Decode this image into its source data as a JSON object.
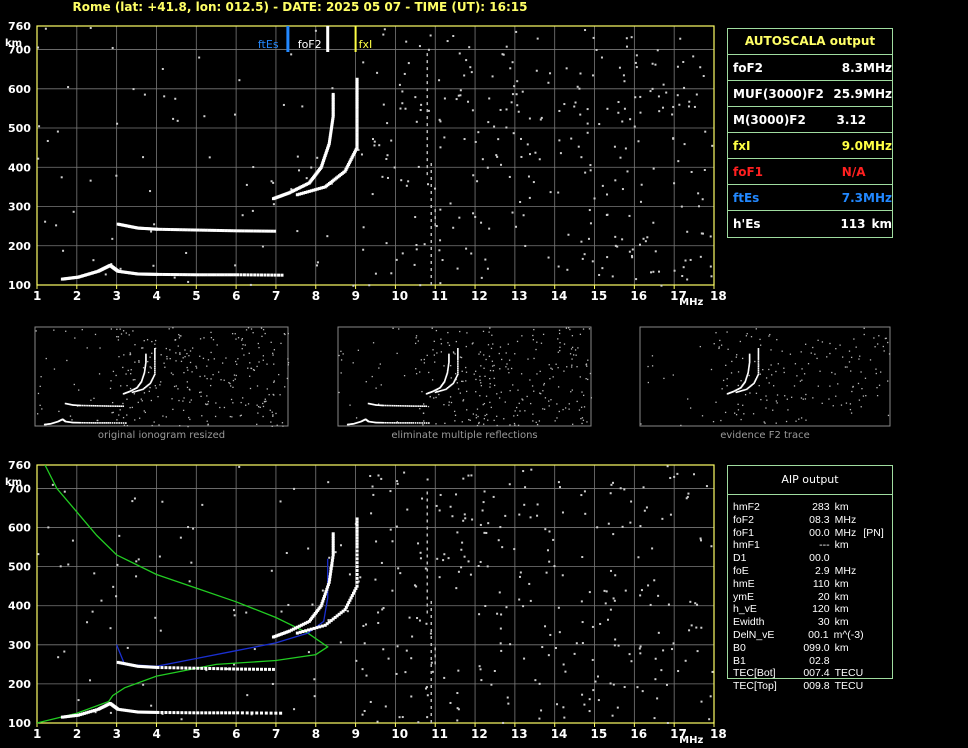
{
  "header": "Rome (lat: +41.8, lon: 012.5) - DATE: 2025 05 07 - TIME (UT): 16:15",
  "colors": {
    "grid": "#7a7a7a",
    "axis": "#ffff66",
    "es": "#2288ff",
    "f1": "#ff2020",
    "fxi": "#ffff44",
    "profile_green": "#22cc22",
    "profile_blue": "#1a2fd0",
    "trace": "#ffffff"
  },
  "axes": {
    "y_unit": "km",
    "x_unit": "MHz",
    "y_ticks": [
      760,
      700,
      600,
      500,
      400,
      300,
      200,
      100
    ],
    "x_ticks": [
      1,
      2,
      3,
      4,
      5,
      6,
      7,
      8,
      9,
      10,
      11,
      12,
      13,
      14,
      15,
      16,
      17,
      18
    ]
  },
  "markers": {
    "ftEs": "ftEs",
    "foF2": "foF2",
    "fxI": "fxI"
  },
  "autoscala": {
    "title": "AUTOSCALA output",
    "rows": [
      {
        "label": "foF2",
        "value": "8.3",
        "unit": "MHz",
        "color": "#ffffff"
      },
      {
        "label": "MUF(3000)F2",
        "value": "25.9",
        "unit": "MHz",
        "color": "#ffffff"
      },
      {
        "label": "M(3000)F2",
        "value": "3.12",
        "unit": "",
        "color": "#ffffff"
      },
      {
        "label": "fxI",
        "value": "9.0",
        "unit": "MHz",
        "color": "#ffff44"
      },
      {
        "label": "foF1",
        "value": "N/A",
        "unit": "",
        "color": "#ff2020"
      },
      {
        "label": "ftEs",
        "value": "7.3",
        "unit": "MHz",
        "color": "#2288ff"
      },
      {
        "label": "h'Es",
        "value": "113",
        "unit": "km",
        "color": "#ffffff"
      }
    ]
  },
  "thumbnails": [
    "original ionogram resized",
    "eliminate multiple reflections",
    "evidence F2 trace"
  ],
  "aip": {
    "title": "AIP output",
    "rows": [
      [
        "hmF2",
        "283",
        "km",
        ""
      ],
      [
        "foF2",
        "08.3",
        "MHz",
        ""
      ],
      [
        "foF1",
        "00.0",
        "MHz",
        "[PN]"
      ],
      [
        "hmF1",
        "---",
        "km",
        ""
      ],
      [
        "D1",
        "00.0",
        "",
        ""
      ],
      [
        "foE",
        "2.9",
        "MHz",
        ""
      ],
      [
        "hmE",
        "110",
        "km",
        ""
      ],
      [
        "ymE",
        "20",
        "km",
        ""
      ],
      [
        "h_vE",
        "120",
        "km",
        ""
      ],
      [
        "Ewidth",
        "30",
        "km",
        ""
      ],
      [
        "DelN_vE",
        "00.1",
        "m^(-3)",
        ""
      ],
      [
        "B0",
        "099.0",
        "km",
        ""
      ],
      [
        "B1",
        "02.8",
        "",
        ""
      ],
      [
        "TEC[Bot]",
        "007.4",
        "TECU",
        ""
      ],
      [
        "TEC[Top]",
        "009.8",
        "TECU",
        ""
      ]
    ]
  },
  "chart_data": [
    {
      "type": "scatter",
      "title": "",
      "xlabel": "MHz",
      "ylabel": "km",
      "xlim": [
        1,
        18
      ],
      "ylim": [
        100,
        760
      ],
      "series": [
        {
          "values": [
            [
              1.6,
              115
            ],
            [
              2.0,
              120
            ],
            [
              2.5,
              135
            ],
            [
              2.8,
              150
            ],
            [
              3.0,
              135
            ],
            [
              3.5,
              128
            ],
            [
              4,
              127
            ],
            [
              5,
              126
            ],
            [
              6,
              126
            ],
            [
              7.2,
              125
            ]
          ]
        },
        {
          "values": [
            [
              3.0,
              255
            ],
            [
              3.5,
              245
            ],
            [
              4,
              242
            ],
            [
              5,
              240
            ],
            [
              6,
              238
            ],
            [
              7,
              237
            ]
          ]
        },
        {
          "values": [
            [
              6.9,
              320
            ],
            [
              7.3,
              335
            ],
            [
              7.8,
              360
            ],
            [
              8.1,
              400
            ],
            [
              8.3,
              460
            ],
            [
              8.4,
              530
            ],
            [
              8.4,
              590
            ]
          ]
        },
        {
          "values": [
            [
              7.5,
              330
            ],
            [
              8.2,
              350
            ],
            [
              8.7,
              390
            ],
            [
              9.0,
              450
            ],
            [
              9.0,
              550
            ],
            [
              9.0,
              630
            ]
          ]
        }
      ]
    },
    {
      "type": "line",
      "title": "",
      "xlabel": "MHz",
      "ylabel": "km",
      "xlim": [
        1,
        18
      ],
      "ylim": [
        100,
        760
      ],
      "series": [
        {
          "values": [
            [
              1.2,
              760
            ],
            [
              1.5,
              700
            ],
            [
              2,
              640
            ],
            [
              2.5,
              580
            ],
            [
              3,
              530
            ],
            [
              4,
              480
            ],
            [
              5,
              445
            ],
            [
              6,
              410
            ],
            [
              7,
              370
            ],
            [
              7.8,
              330
            ],
            [
              8.3,
              295
            ],
            [
              8,
              275
            ],
            [
              7,
              260
            ],
            [
              5.5,
              250
            ],
            [
              4,
              220
            ],
            [
              3.2,
              190
            ],
            [
              2.9,
              170
            ],
            [
              2.8,
              155
            ],
            [
              2,
              125
            ],
            [
              1,
              100
            ]
          ]
        },
        {
          "values": [
            [
              3,
              300
            ],
            [
              3.2,
              250
            ],
            [
              4,
              245
            ],
            [
              5,
              265
            ],
            [
              6,
              285
            ],
            [
              7,
              305
            ],
            [
              7.8,
              330
            ],
            [
              8.2,
              360
            ],
            [
              8.3,
              420
            ],
            [
              8.3,
              520
            ]
          ]
        }
      ]
    }
  ]
}
